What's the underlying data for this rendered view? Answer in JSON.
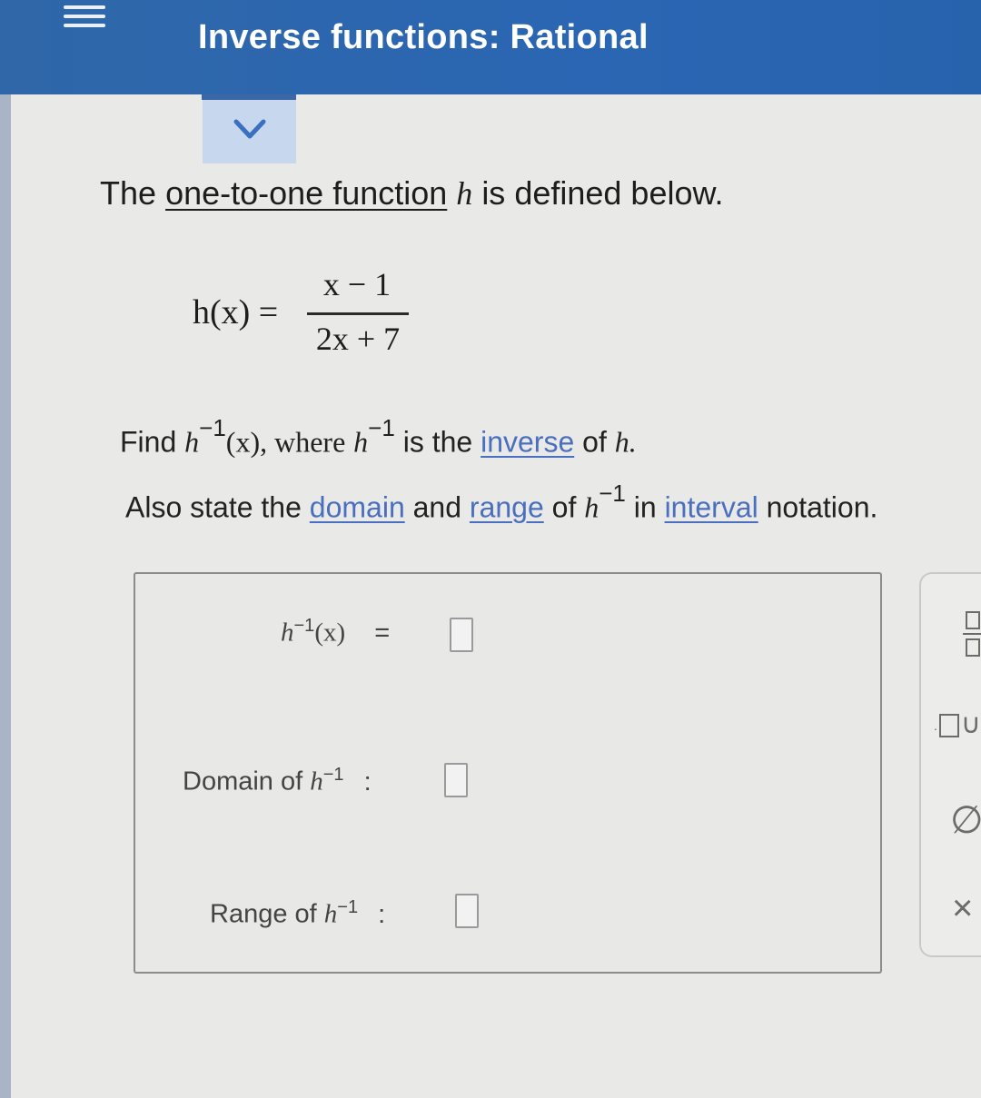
{
  "header": {
    "title": "Inverse functions: Rational"
  },
  "problem": {
    "intro_before": "The",
    "intro_link": "one-to-one function",
    "intro_var": "h",
    "intro_after": "is defined below.",
    "function_lhs": "h(x) =",
    "numerator": "x − 1",
    "denominator": "2x + 7",
    "find_text": "Find",
    "find_var": "h",
    "find_sup": "−1",
    "find_arg": "(x), where",
    "where_var": "h",
    "where_sup": "−1",
    "is_the": "is the",
    "inverse_link": "inverse",
    "of_text": "of",
    "of_var": "h.",
    "also_text": "Also state the",
    "domain_link": "domain",
    "and_text": "and",
    "range_link": "range",
    "of_text2": "of",
    "of_var2": "h",
    "of_sup2": "−1",
    "in_text": "in",
    "interval_link": "interval",
    "notation_text": "notation."
  },
  "answer": {
    "inverse_var": "h",
    "inverse_sup": "−1",
    "inverse_arg": "(x)",
    "equals": "=",
    "domain_label": "Domain of",
    "domain_var": "h",
    "domain_sup": "−1",
    "domain_colon": ":",
    "range_label": "Range of",
    "range_var": "h",
    "range_sup": "−1",
    "range_colon": ":"
  },
  "tools": {
    "union": "∪",
    "empty_set": "∅",
    "clear": "×"
  },
  "icons": [
    "menu-icon",
    "chevron-down-icon",
    "fraction-icon",
    "union-icon",
    "empty-set-icon",
    "clear-icon"
  ],
  "colors": {
    "header": "#2a66b3",
    "link": "#4a6fbf",
    "collapse_button": "#c7d8ee"
  }
}
